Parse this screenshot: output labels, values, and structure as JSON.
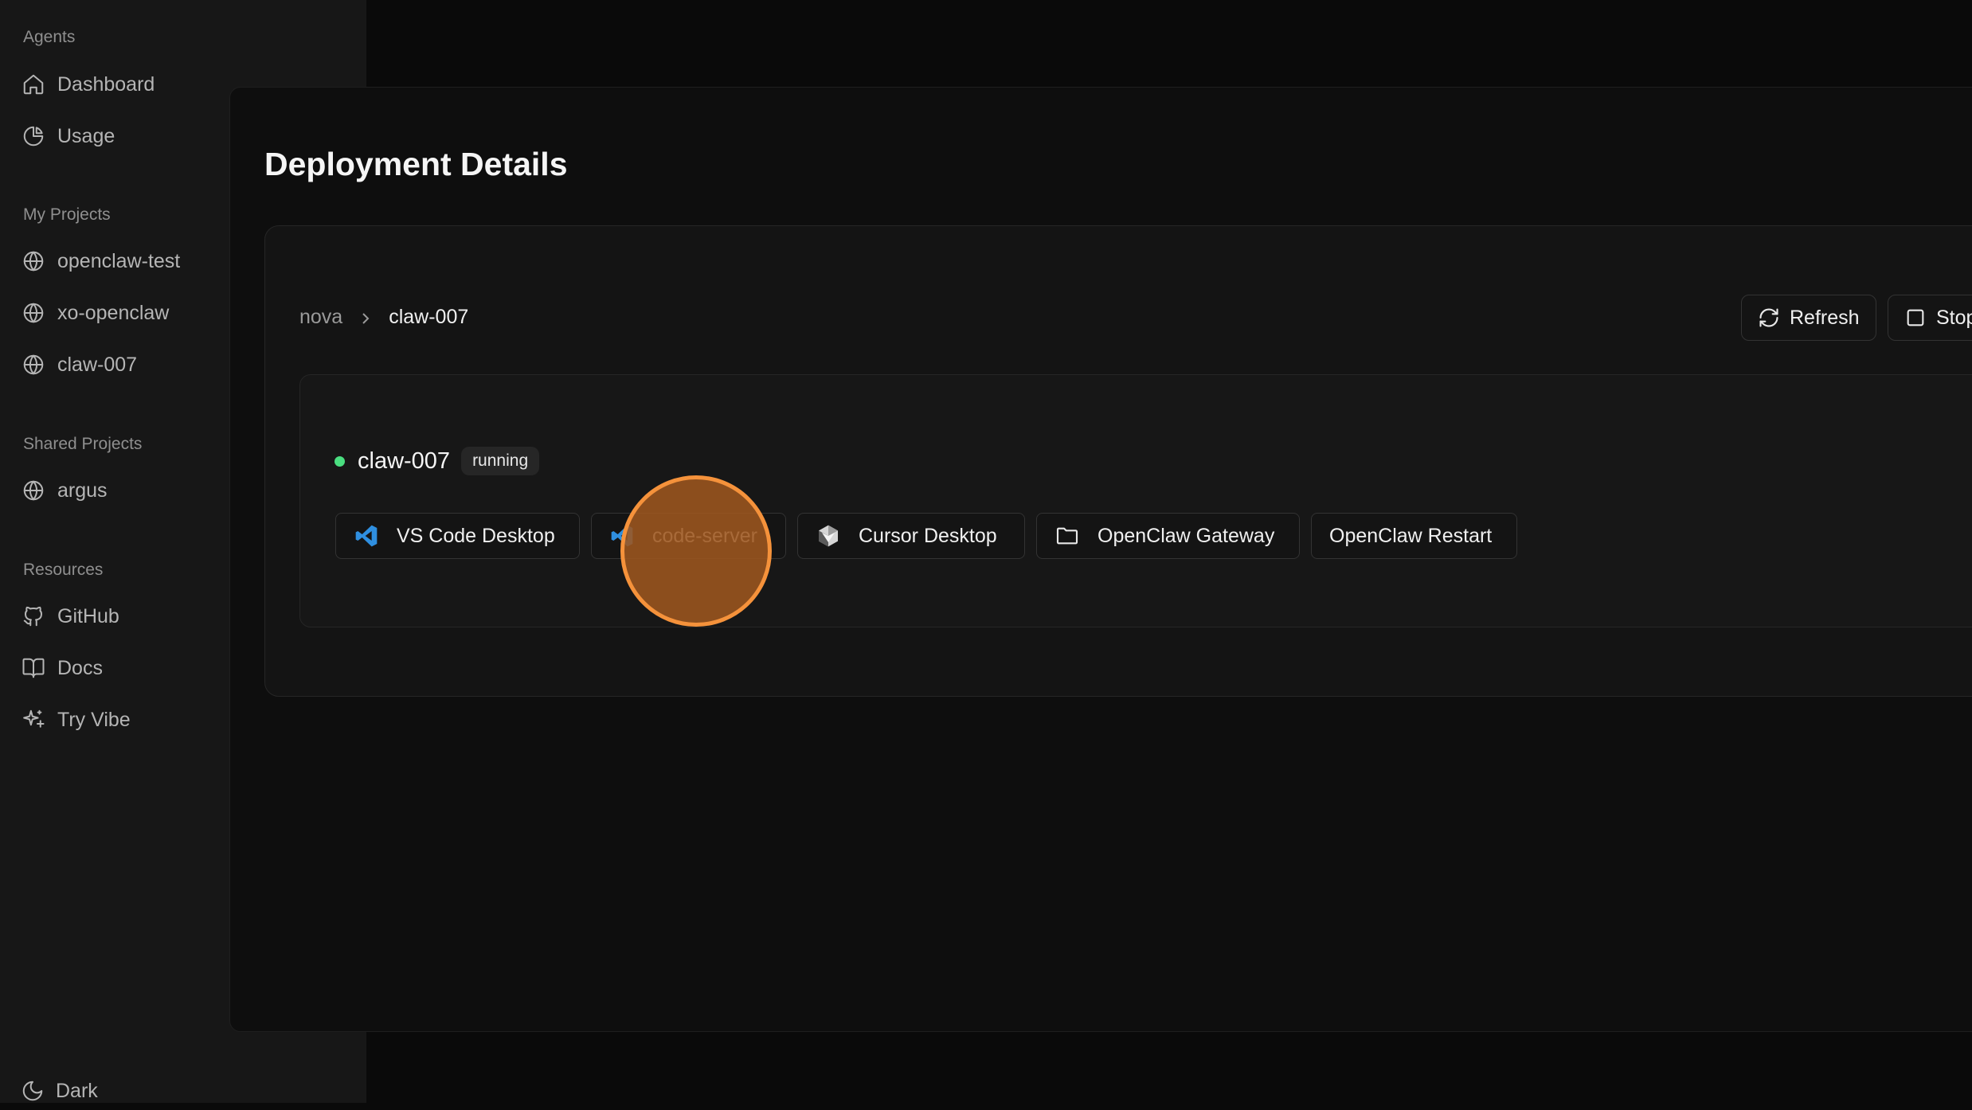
{
  "sidebar": {
    "agents_label": "Agents",
    "agents_items": [
      {
        "label": "Dashboard",
        "icon": "home-icon"
      },
      {
        "label": "Usage",
        "icon": "pie-chart-icon"
      }
    ],
    "my_projects_label": "My Projects",
    "my_projects": [
      {
        "label": "openclaw-test",
        "icon": "globe-icon"
      },
      {
        "label": "xo-openclaw",
        "icon": "globe-icon"
      },
      {
        "label": "claw-007",
        "icon": "globe-icon"
      }
    ],
    "shared_projects_label": "Shared Projects",
    "shared_projects": [
      {
        "label": "argus",
        "icon": "globe-icon"
      }
    ],
    "resources_label": "Resources",
    "resources": [
      {
        "label": "GitHub",
        "icon": "github-icon"
      },
      {
        "label": "Docs",
        "icon": "book-icon"
      },
      {
        "label": "Try Vibe",
        "icon": "sparkles-icon"
      }
    ],
    "theme_label": "Dark"
  },
  "page": {
    "title": "Deployment Details"
  },
  "breadcrumb": {
    "root": "nova",
    "current": "claw-007"
  },
  "toolbar": {
    "refresh_label": "Refresh",
    "stop_label": "Stop"
  },
  "deployment": {
    "name": "claw-007",
    "status": "running",
    "status_color": "#4ade80"
  },
  "actions": [
    {
      "label": "VS Code Desktop",
      "icon": "vscode-icon"
    },
    {
      "label": "code-server",
      "icon": "vscode-icon"
    },
    {
      "label": "Cursor Desktop",
      "icon": "cursor-icon"
    },
    {
      "label": "OpenClaw Gateway",
      "icon": "folder-icon"
    },
    {
      "label": "OpenClaw Restart",
      "icon": ""
    }
  ],
  "colors": {
    "accent_cursor": "#f5923b",
    "vscode_blue": "#2f8fe0"
  }
}
